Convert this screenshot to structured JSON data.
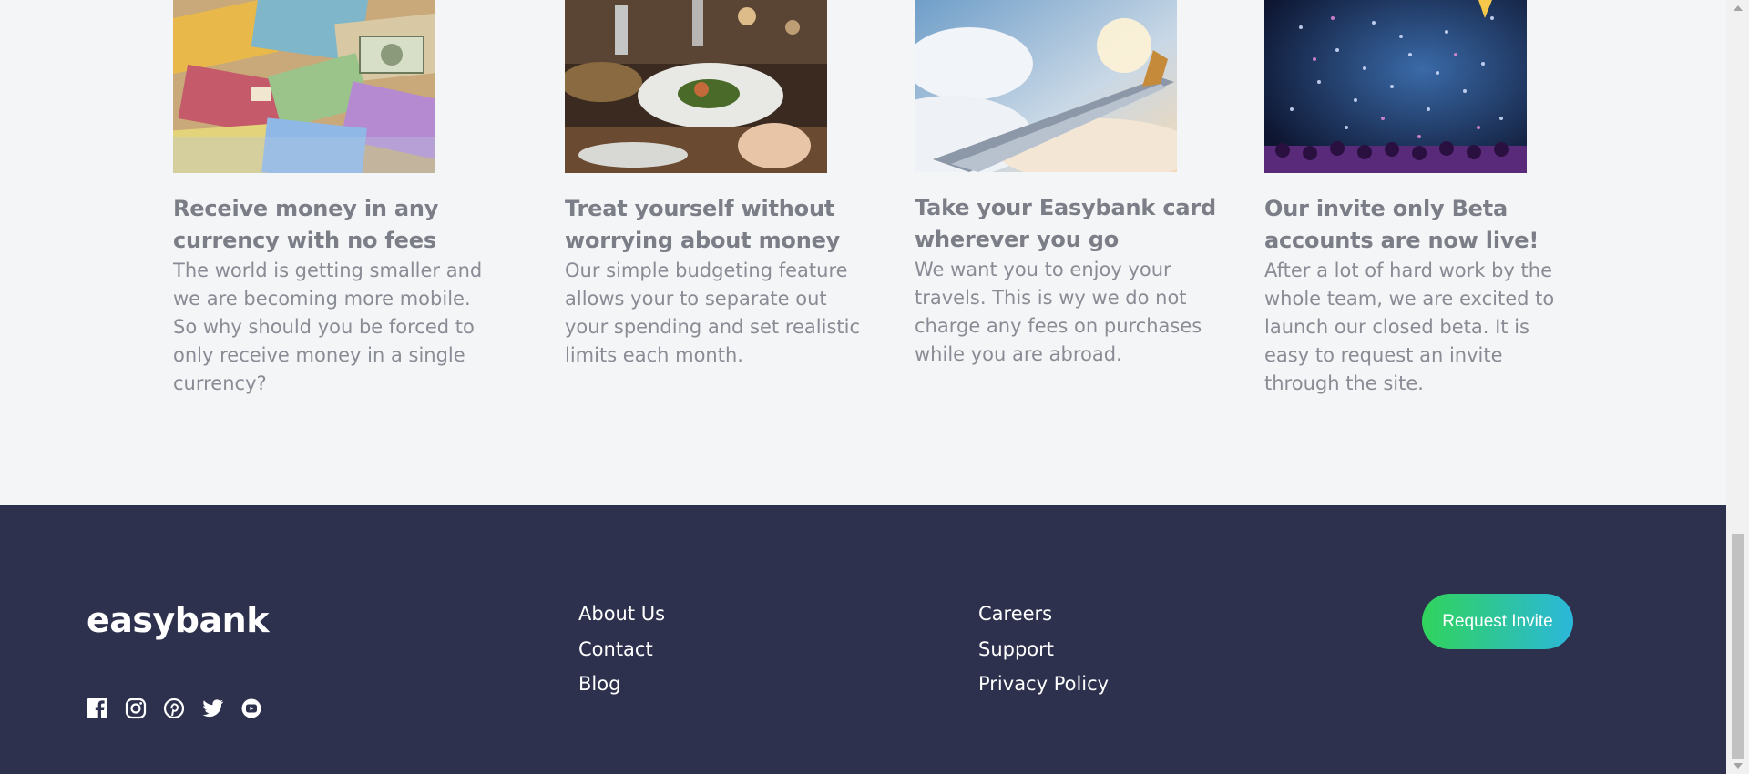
{
  "articles": [
    {
      "title": "Receive money in any currency with no fees",
      "body": "The world is getting smaller and we are becoming more mobile. So why should you be forced to only receive money in a single currency?"
    },
    {
      "title": "Treat yourself without worrying about money",
      "body": "Our simple budgeting feature allows your to separate out your spending and set realistic limits each month."
    },
    {
      "title": "Take your Easybank card wherever you go",
      "body": "We want you to enjoy your travels. This is wy we do not charge any fees on purchases while you are abroad."
    },
    {
      "title": "Our invite only Beta accounts are now live!",
      "body": "After a lot of hard work by the whole team, we are excited to launch our closed beta. It is easy to request an invite through the site."
    }
  ],
  "footer": {
    "logo": "easybank",
    "links_col1": [
      "About Us",
      "Contact",
      "Blog"
    ],
    "links_col2": [
      "Careers",
      "Support",
      "Privacy Policy"
    ],
    "cta_label": "Request Invite",
    "social_icons": [
      "facebook-icon",
      "instagram-icon",
      "pinterest-icon",
      "twitter-icon",
      "youtube-icon"
    ]
  },
  "colors": {
    "footer_bg": "#2d314d",
    "page_bg": "#f4f5f7",
    "heading": "#7b7d87",
    "text": "#8a8c95",
    "cta_gradient_start": "#31d35c",
    "cta_gradient_end": "#2bb7da"
  }
}
